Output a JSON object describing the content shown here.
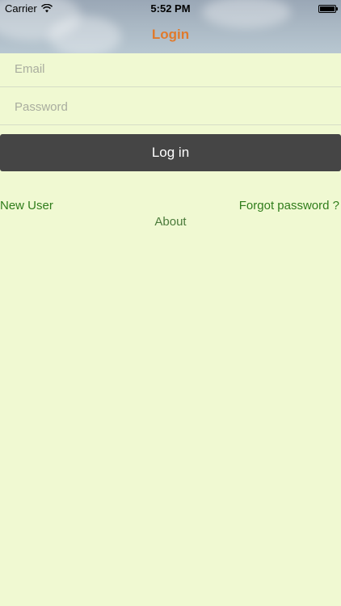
{
  "status_bar": {
    "carrier": "Carrier",
    "time": "5:52 PM",
    "wifi_icon": "wifi-icon",
    "battery_icon": "battery-icon"
  },
  "nav": {
    "title": "Login",
    "title_color": "#e07a2c"
  },
  "form": {
    "email_placeholder": "Email",
    "email_value": "",
    "password_placeholder": "Password",
    "password_value": ""
  },
  "actions": {
    "login_label": "Log in",
    "new_user_label": "New User",
    "forgot_password_label": "Forgot password ?",
    "about_label": "About"
  },
  "colors": {
    "background": "#f0f9d2",
    "button": "#454545",
    "link": "#2f7d1b"
  }
}
